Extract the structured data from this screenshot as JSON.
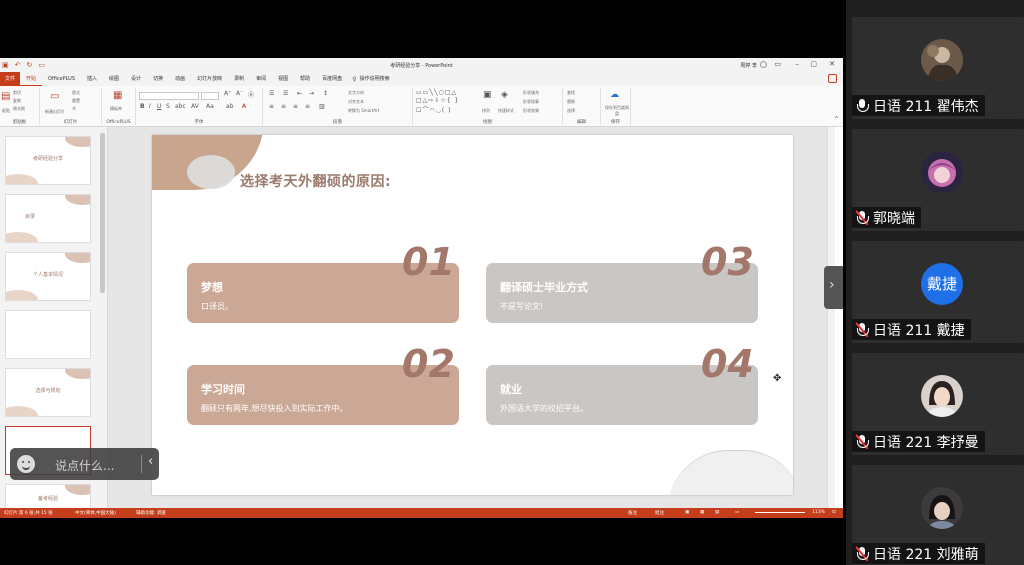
{
  "window": {
    "title": "考研经验分享 - PowerPoint",
    "user": "周婷 李"
  },
  "ribbon_tabs": [
    "文件",
    "开始",
    "OfficePLUS",
    "插入",
    "绘图",
    "设计",
    "切换",
    "动画",
    "幻灯片放映",
    "录制",
    "审阅",
    "视图",
    "帮助",
    "百度网盘"
  ],
  "tell_me": "操作说明搜索",
  "ribbon": {
    "groups": [
      "剪贴板",
      "幻灯片",
      "OfficePLUS",
      "字体",
      "段落",
      "绘图",
      "编辑",
      "保存"
    ],
    "paste": "粘贴",
    "cut": "剪切",
    "copy": "复制",
    "format_painter": "格式刷",
    "new_slide": "新建幻灯片",
    "layout": "版式",
    "reset": "重置",
    "section": "节",
    "template_lib": "模板库",
    "find": "查找",
    "replace": "替换",
    "select": "选择",
    "save_baidu": "保存到百度网盘",
    "arrange": "排列",
    "quick_styles": "快速样式",
    "shape_fill": "形状填充",
    "shape_outline": "形状轮廓",
    "shape_effects": "形状效果",
    "text_direction": "文字方向",
    "align_text": "对齐文本",
    "smartart": "转换为 SmartArt"
  },
  "thumbnails": [
    {
      "title": "考研经验分享"
    },
    {
      "title": "目录"
    },
    {
      "title": "个人基本情况"
    },
    {
      "title": ""
    },
    {
      "title": "选择与规划"
    },
    {
      "title": ""
    },
    {
      "title": "备考经验"
    }
  ],
  "slide": {
    "title": "选择考天外翻硕的原因:",
    "cards": [
      {
        "num": "01",
        "title": "梦想",
        "desc": "口译员。"
      },
      {
        "num": "03",
        "title": "翻译硕士毕业方式",
        "desc": "不是写论文!"
      },
      {
        "num": "02",
        "title": "学习时间",
        "desc": "翻硕只有两年,想尽快投入到实际工作中。"
      },
      {
        "num": "04",
        "title": "就业",
        "desc": "外国语大学的校招平台。"
      }
    ]
  },
  "statusbar": {
    "slide_info": "幻灯片 第 6 张,共 15 张",
    "language": "中文(简体,中国大陆)",
    "accessibility": "辅助功能: 调查",
    "notes": "备注",
    "comments": "批注",
    "zoom": "113%"
  },
  "chat": {
    "placeholder": "说点什么..."
  },
  "participants": [
    {
      "name": "日语 211 翟伟杰",
      "muted": false,
      "avatar": "photo"
    },
    {
      "name": "郭晓端",
      "muted": true,
      "avatar": "photo"
    },
    {
      "name": "日语 211 戴捷",
      "muted": true,
      "avatar": "text",
      "avatar_text": "戴捷"
    },
    {
      "name": "日语 221 李抒曼",
      "muted": true,
      "avatar": "photo"
    },
    {
      "name": "日语 221 刘雅萌",
      "muted": true,
      "avatar": "photo"
    }
  ],
  "colors": {
    "accent": "#c43e1c",
    "card_brown": "#cba795",
    "card_gray": "#c9c6c4",
    "number": "#a3786a",
    "avatar_blue": "#1e6fe8"
  }
}
